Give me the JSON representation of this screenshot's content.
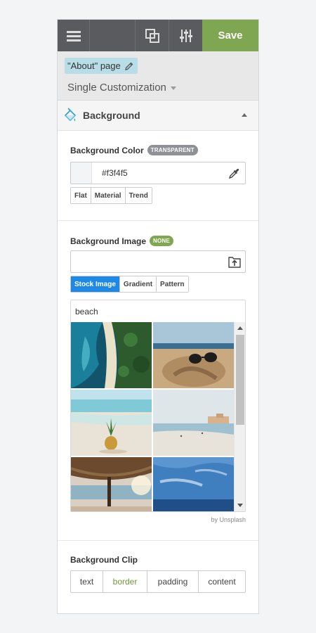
{
  "toolbar": {
    "save_label": "Save",
    "icons": [
      "hamburger-menu-icon",
      "layers-icon",
      "sliders-icon"
    ]
  },
  "page": {
    "chip_label": "\"About\" page",
    "customization_label": "Single Customization"
  },
  "section": {
    "title": "Background",
    "icon": "paint-bucket-icon"
  },
  "background_color": {
    "label": "Background Color",
    "badge": "TRANSPARENT",
    "value": "#f3f4f5",
    "swatch_color": "#f3f4f5",
    "palettes": [
      "Flat",
      "Material",
      "Trend"
    ]
  },
  "background_image": {
    "label": "Background Image",
    "badge": "NONE",
    "value": "",
    "tabs": [
      "Stock Image",
      "Gradient",
      "Pattern"
    ],
    "active_tab": "Stock Image",
    "search_value": "beach",
    "credit": "by Unsplash"
  },
  "background_clip": {
    "label": "Background Clip",
    "options": [
      "text",
      "border",
      "padding",
      "content"
    ],
    "active": "border"
  },
  "colors": {
    "save_green": "#7fa650",
    "toolbar_dark": "#595b5e",
    "active_blue": "#1e88e5",
    "chip_blue": "#b8dde6"
  }
}
